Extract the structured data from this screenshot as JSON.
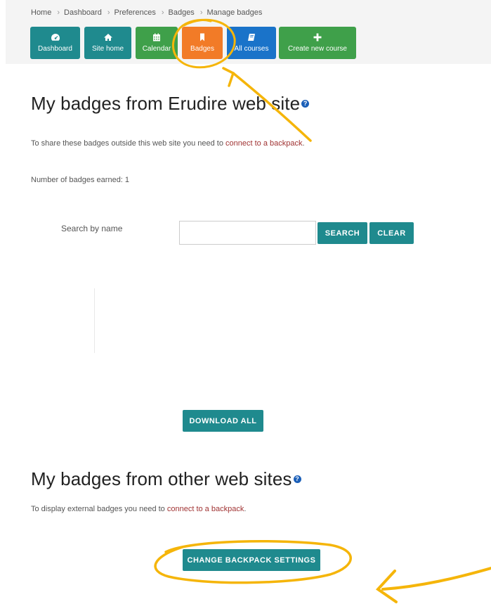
{
  "breadcrumb": [
    "Home",
    "Dashboard",
    "Preferences",
    "Badges",
    "Manage badges"
  ],
  "nav": {
    "dashboard": "Dashboard",
    "site_home": "Site home",
    "calendar": "Calendar",
    "badges": "Badges",
    "all_courses": "All courses",
    "create_course": "Create new course"
  },
  "section1": {
    "title": "My badges from Erudire web site",
    "share_prefix": "To share these badges outside this web site you need to ",
    "share_link": "connect to a backpack",
    "share_suffix": ".",
    "earned": "Number of badges earned: 1"
  },
  "search": {
    "label": "Search by name",
    "value": "",
    "search_button": "SEARCH",
    "clear_button": "CLEAR"
  },
  "download_all": "DOWNLOAD ALL",
  "section2": {
    "title": "My badges from other web sites",
    "display_prefix": "To display external badges you need to ",
    "display_link": "connect to a backpack",
    "display_suffix": "."
  },
  "change_backpack": "CHANGE BACKPACK SETTINGS",
  "colors": {
    "teal": "#1f8a8e",
    "green": "#3fa04a",
    "orange": "#f27b27",
    "blue": "#1a73c9",
    "link": "#a03333",
    "highlight": "#f5b50a"
  },
  "icons": [
    "dashboard-icon",
    "home-icon",
    "calendar-icon",
    "bookmark-icon",
    "book-icon",
    "plus-icon",
    "help-icon"
  ]
}
